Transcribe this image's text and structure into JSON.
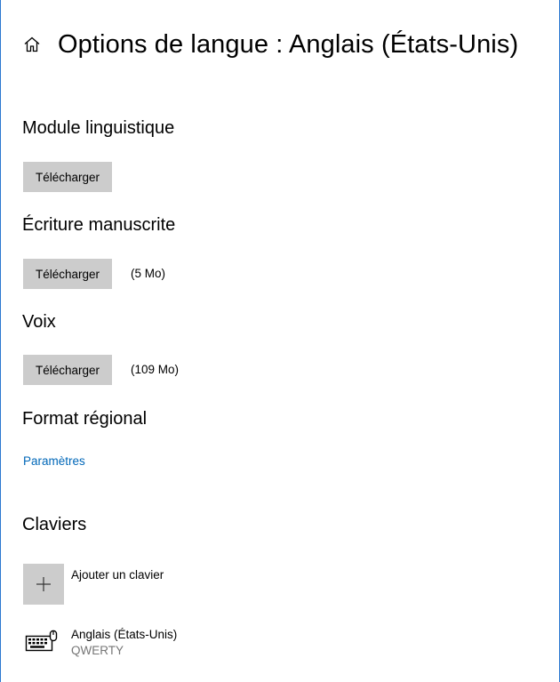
{
  "header": {
    "title": "Options de langue : Anglais (États-Unis)",
    "home_icon": "home-icon"
  },
  "sections": {
    "language_pack": {
      "title": "Module linguistique",
      "button": "Télécharger"
    },
    "handwriting": {
      "title": "Écriture manuscrite",
      "button": "Télécharger",
      "size": "(5 Mo)"
    },
    "speech": {
      "title": "Voix",
      "button": "Télécharger",
      "size": "(109 Mo)"
    },
    "regional_format": {
      "title": "Format régional",
      "link": "Paramètres"
    },
    "keyboards": {
      "title": "Claviers",
      "add_label": "Ajouter un clavier",
      "items": [
        {
          "name": "Anglais (États-Unis)",
          "layout": "QWERTY",
          "icon": "keyboard-icon"
        }
      ]
    }
  },
  "colors": {
    "accent": "#0067b8",
    "button_bg": "#cccccc",
    "window_border": "#2b78d0",
    "secondary_text": "#767676"
  }
}
